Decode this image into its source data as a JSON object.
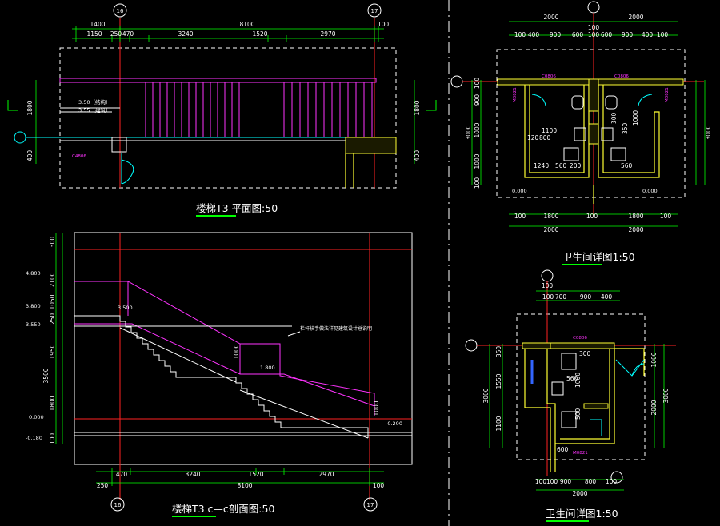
{
  "plan": {
    "title": "楼梯T3 平面图:50",
    "axis_left": "16",
    "axis_right": "17",
    "dims_top_total": [
      "1400",
      "8100",
      "100"
    ],
    "dims_top_parts": [
      "1150",
      "250",
      "470",
      "3240",
      "1520",
      "2970"
    ],
    "dims_left": [
      "1800",
      "400"
    ],
    "dims_right": [
      "1800",
      "400"
    ],
    "level_a": "3.50（结构）",
    "level_b": "3.55（建筑）",
    "tag_c": "C4806"
  },
  "section": {
    "title": "楼梯T3 c—c剖面图:50",
    "axis_left": "16",
    "axis_right": "17",
    "levels": [
      "4.800",
      "3.800",
      "3.550",
      "0.000",
      "-0.180"
    ],
    "level_landing": "3.500",
    "level_mid": "1.800",
    "level_floor": "-0.200",
    "dims_left": [
      "300",
      "2100",
      "1050",
      "250",
      "1950",
      "3500",
      "1800",
      "100"
    ],
    "dims_mid": [
      "1000",
      "1000"
    ],
    "note": "栏杆扶手做法详见建筑设计总说明",
    "dims_bottom_parts": [
      "470",
      "3240",
      "1520",
      "2970"
    ],
    "dims_bottom_total": [
      "250",
      "8100",
      "100"
    ]
  },
  "toilet1": {
    "title": "卫生间详图1:50",
    "dims_top_total": [
      "2000",
      "2000"
    ],
    "dims_top_parts": [
      "100",
      "400",
      "900",
      "600",
      "100",
      "600",
      "900",
      "400",
      "100"
    ],
    "dims_top_small": "100",
    "dims_bottom_parts": [
      "100",
      "1800",
      "100",
      "1800",
      "100"
    ],
    "dims_bottom_total": [
      "2000",
      "2000"
    ],
    "dims_side_outer": "3000",
    "dims_side_parts": [
      "100",
      "900",
      "1000",
      "1000",
      "100"
    ],
    "dims_inner": [
      "1100",
      "120",
      "800",
      "1240",
      "560",
      "200",
      "560",
      "1000",
      "300",
      "350"
    ],
    "tags": [
      "C0806",
      "C0806",
      "M0821",
      "M0821"
    ],
    "levels": [
      "0.000",
      "0.000"
    ]
  },
  "toilet2": {
    "title": "卫生间详图1:50",
    "dims_top_small": "100",
    "dims_top_parts": [
      "100",
      "700",
      "900",
      "400"
    ],
    "dims_bottom_parts": [
      "100",
      "100",
      "900",
      "800",
      "100"
    ],
    "dims_bottom_total": "2000",
    "dims_left_outer": "3000",
    "dims_left_parts": [
      "350",
      "1550",
      "1100"
    ],
    "dims_right_outer": "3000",
    "dims_right_parts": [
      "1000",
      "2000"
    ],
    "dims_inner": [
      "560",
      "1000",
      "600",
      "500"
    ],
    "tags": [
      "C0806",
      "M0821"
    ],
    "dims_top_fixture": "300"
  },
  "colors": {
    "dimension": "#00ff00",
    "axis": "#ff2222",
    "rail": "#ff33ff",
    "wall": "#ffff33",
    "text": "#ffffff"
  }
}
